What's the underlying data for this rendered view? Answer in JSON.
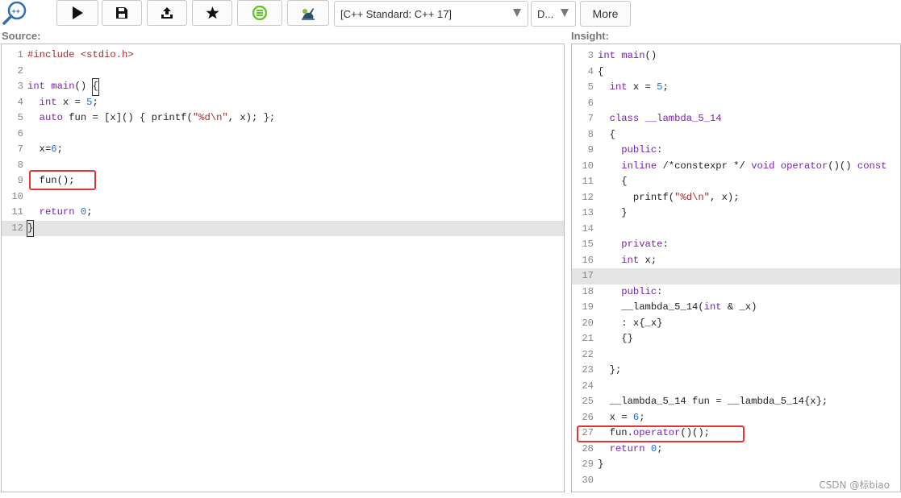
{
  "toolbar": {
    "logo_icon": "cppinsights-logo-icon",
    "buttons": [
      {
        "name": "run-button",
        "icon": "play-icon"
      },
      {
        "name": "save-button",
        "icon": "floppy-disk-icon"
      },
      {
        "name": "share-button",
        "icon": "upload-icon"
      },
      {
        "name": "favorite-button",
        "icon": "star-icon"
      },
      {
        "name": "compiler-explorer-button",
        "icon": "compiler-explorer-icon"
      },
      {
        "name": "quick-bench-button",
        "icon": "rabbit-icon"
      }
    ],
    "standard_select": "[C++ Standard: C++ 17]",
    "options_select": "D...",
    "more_label": "More"
  },
  "source": {
    "title": "Source:",
    "highlighted_line": 12,
    "lines": [
      {
        "n": "1",
        "code": [
          {
            "t": "#include <stdio.h>",
            "c": "p"
          }
        ]
      },
      {
        "n": "2",
        "code": []
      },
      {
        "n": "3",
        "code": [
          {
            "t": "int",
            "c": "k"
          },
          {
            "t": " "
          },
          {
            "t": "main",
            "c": "f"
          },
          {
            "t": "() "
          },
          {
            "t": "{",
            "c": "cursor"
          }
        ]
      },
      {
        "n": "4",
        "code": [
          {
            "t": "  "
          },
          {
            "t": "int",
            "c": "k"
          },
          {
            "t": " x = "
          },
          {
            "t": "5",
            "c": "n"
          },
          {
            "t": ";"
          }
        ]
      },
      {
        "n": "5",
        "code": [
          {
            "t": "  "
          },
          {
            "t": "auto",
            "c": "k"
          },
          {
            "t": " fun = [x]() { printf("
          },
          {
            "t": "\"%d\\n\"",
            "c": "s"
          },
          {
            "t": ", x); };"
          }
        ]
      },
      {
        "n": "6",
        "code": []
      },
      {
        "n": "7",
        "code": [
          {
            "t": "  x="
          },
          {
            "t": "6",
            "c": "n"
          },
          {
            "t": ";"
          }
        ]
      },
      {
        "n": "8",
        "code": []
      },
      {
        "n": "9",
        "code": [
          {
            "t": "  fun();"
          }
        ]
      },
      {
        "n": "10",
        "code": []
      },
      {
        "n": "11",
        "code": [
          {
            "t": "  "
          },
          {
            "t": "return",
            "c": "k"
          },
          {
            "t": " "
          },
          {
            "t": "0",
            "c": "n"
          },
          {
            "t": ";"
          }
        ]
      },
      {
        "n": "12",
        "code": [
          {
            "t": "}",
            "c": "cursor"
          }
        ]
      }
    ]
  },
  "insight": {
    "title": "Insight:",
    "highlighted_line": 17,
    "lines": [
      {
        "n": "3",
        "code": [
          {
            "t": "int",
            "c": "k"
          },
          {
            "t": " "
          },
          {
            "t": "main",
            "c": "f"
          },
          {
            "t": "()"
          }
        ]
      },
      {
        "n": "4",
        "code": [
          {
            "t": "{"
          }
        ]
      },
      {
        "n": "5",
        "code": [
          {
            "t": "  "
          },
          {
            "t": "int",
            "c": "k"
          },
          {
            "t": " x = "
          },
          {
            "t": "5",
            "c": "n"
          },
          {
            "t": ";"
          }
        ]
      },
      {
        "n": "6",
        "code": []
      },
      {
        "n": "7",
        "code": [
          {
            "t": "  "
          },
          {
            "t": "class",
            "c": "k"
          },
          {
            "t": " "
          },
          {
            "t": "__lambda_5_14",
            "c": "f"
          }
        ]
      },
      {
        "n": "8",
        "code": [
          {
            "t": "  {"
          }
        ]
      },
      {
        "n": "9",
        "code": [
          {
            "t": "    "
          },
          {
            "t": "public",
            "c": "k"
          },
          {
            "t": ":"
          }
        ]
      },
      {
        "n": "10",
        "code": [
          {
            "t": "    "
          },
          {
            "t": "inline",
            "c": "k"
          },
          {
            "t": " /*constexpr */ "
          },
          {
            "t": "void",
            "c": "k"
          },
          {
            "t": " "
          },
          {
            "t": "operator",
            "c": "k"
          },
          {
            "t": "()() "
          },
          {
            "t": "const",
            "c": "k"
          }
        ]
      },
      {
        "n": "11",
        "code": [
          {
            "t": "    {"
          }
        ]
      },
      {
        "n": "12",
        "code": [
          {
            "t": "      printf("
          },
          {
            "t": "\"%d\\n\"",
            "c": "s"
          },
          {
            "t": ", x);"
          }
        ]
      },
      {
        "n": "13",
        "code": [
          {
            "t": "    }"
          }
        ]
      },
      {
        "n": "14",
        "code": []
      },
      {
        "n": "15",
        "code": [
          {
            "t": "    "
          },
          {
            "t": "private",
            "c": "k"
          },
          {
            "t": ":"
          }
        ]
      },
      {
        "n": "16",
        "code": [
          {
            "t": "    "
          },
          {
            "t": "int",
            "c": "k"
          },
          {
            "t": " x;"
          }
        ]
      },
      {
        "n": "17",
        "code": []
      },
      {
        "n": "18",
        "code": [
          {
            "t": "    "
          },
          {
            "t": "public",
            "c": "k"
          },
          {
            "t": ":"
          }
        ]
      },
      {
        "n": "19",
        "code": [
          {
            "t": "    __lambda_5_14("
          },
          {
            "t": "int",
            "c": "k"
          },
          {
            "t": " & _x)"
          }
        ]
      },
      {
        "n": "20",
        "code": [
          {
            "t": "    : x{_x}"
          }
        ]
      },
      {
        "n": "21",
        "code": [
          {
            "t": "    {}"
          }
        ]
      },
      {
        "n": "22",
        "code": []
      },
      {
        "n": "23",
        "code": [
          {
            "t": "  };"
          }
        ]
      },
      {
        "n": "24",
        "code": []
      },
      {
        "n": "25",
        "code": [
          {
            "t": "  __lambda_5_14 fun = __lambda_5_14{x};"
          }
        ]
      },
      {
        "n": "26",
        "code": [
          {
            "t": "  x = "
          },
          {
            "t": "6",
            "c": "n"
          },
          {
            "t": ";"
          }
        ]
      },
      {
        "n": "27",
        "code": [
          {
            "t": "  fun."
          },
          {
            "t": "operator",
            "c": "k"
          },
          {
            "t": "()();"
          }
        ]
      },
      {
        "n": "28",
        "code": [
          {
            "t": "  "
          },
          {
            "t": "return",
            "c": "k"
          },
          {
            "t": " "
          },
          {
            "t": "0",
            "c": "n"
          },
          {
            "t": ";"
          }
        ]
      },
      {
        "n": "29",
        "code": [
          {
            "t": "}"
          }
        ]
      },
      {
        "n": "30",
        "code": []
      }
    ]
  },
  "annotations": {
    "color": "#e53333",
    "source_box_line": 9,
    "insight_box_line": 27
  },
  "watermark": "CSDN @标biao"
}
